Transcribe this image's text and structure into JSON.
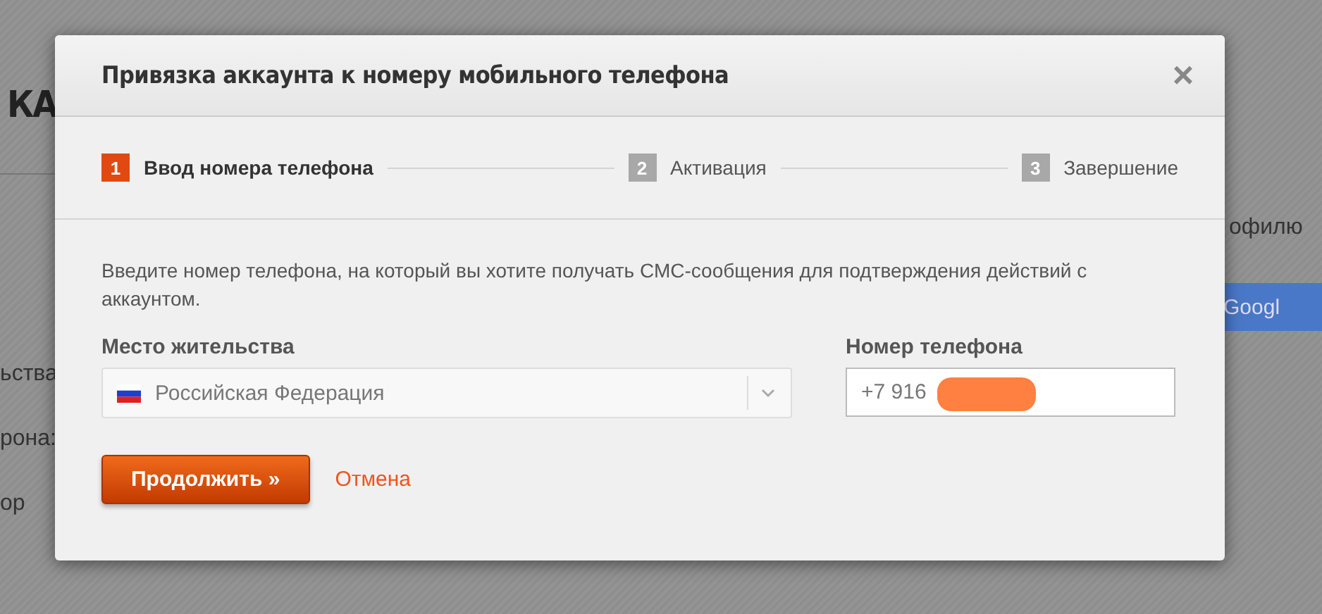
{
  "background_page": {
    "heading": "КА",
    "right_texts": [
      "офилю"
    ],
    "google_button": "Googl",
    "left_labels": [
      "ьства",
      "рона:",
      "ор"
    ]
  },
  "dialog": {
    "title": "Привязка аккаунта к номеру мобильного телефона",
    "close": "×",
    "steps": [
      {
        "number": "1",
        "label": "Ввод номера телефона",
        "selected": true
      },
      {
        "number": "2",
        "label": "Активация",
        "selected": false
      },
      {
        "number": "3",
        "label": "Завершение",
        "selected": false
      }
    ],
    "description": "Введите номер телефона, на который вы хотите получать СМС-сообщения для подтверждения действий с аккаунтом.",
    "residence": {
      "label": "Место жительства",
      "value": "Российская Федерация"
    },
    "phone": {
      "label": "Номер телефона",
      "value": "+7 916",
      "redacted": true
    },
    "continue_button": "Продолжить »",
    "cancel_link": "Отмена"
  }
}
